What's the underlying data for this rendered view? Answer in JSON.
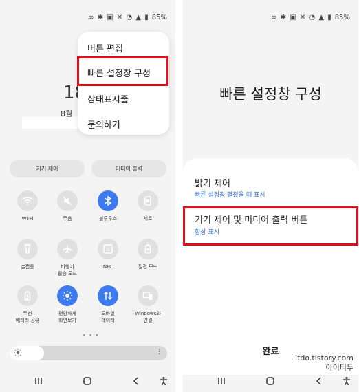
{
  "status_bar": {
    "battery": "85%"
  },
  "left": {
    "menu": [
      "버튼 편집",
      "빠른 설정창 구성",
      "상태표시줄",
      "문의하기"
    ],
    "clock_partial": "18",
    "date_partial": "8월",
    "controls": {
      "device_control": "기기 제어",
      "media_output": "미디어 출력"
    },
    "tiles": [
      {
        "label": "Wi-Fi",
        "icon": "wifi-icon",
        "on": false
      },
      {
        "label": "무음",
        "icon": "mute-icon",
        "on": false
      },
      {
        "label": "블루투스",
        "icon": "bluetooth-icon",
        "on": true
      },
      {
        "label": "세로",
        "icon": "portrait-icon",
        "on": false
      },
      {
        "label": "손전등",
        "icon": "flashlight-icon",
        "on": false
      },
      {
        "label": "비행기\n탑승 모드",
        "icon": "airplane-icon",
        "on": false
      },
      {
        "label": "NFC",
        "icon": "nfc-icon",
        "on": false
      },
      {
        "label": "절전 모드",
        "icon": "power-saving-icon",
        "on": false
      },
      {
        "label": "무선\n배터리 공유",
        "icon": "wireless-battery-icon",
        "on": false
      },
      {
        "label": "편안하게\n화면보기",
        "icon": "eye-comfort-icon",
        "on": true
      },
      {
        "label": "모바일\n데이터",
        "icon": "mobile-data-icon",
        "on": true
      },
      {
        "label": "Windows와\n연결",
        "icon": "link-windows-icon",
        "on": false
      }
    ],
    "page_dots": "• • •",
    "brightness_level": 0.22,
    "colors": {
      "accent": "#3e7bf0",
      "highlight": "#e0101a"
    }
  },
  "right": {
    "title": "빠른 설정창 구성",
    "options": [
      {
        "title": "밝기 제어",
        "subtitle": "빠른 설정창 펼쳤을 때 표시"
      },
      {
        "title": "기기 제어 및 미디어 출력 버튼",
        "subtitle": "항상 표시"
      }
    ],
    "done": "완료",
    "subtitle_color": "#2f6fd6"
  },
  "watermark": {
    "line1": "itdo.tistory.com",
    "line2": "아이티두"
  }
}
